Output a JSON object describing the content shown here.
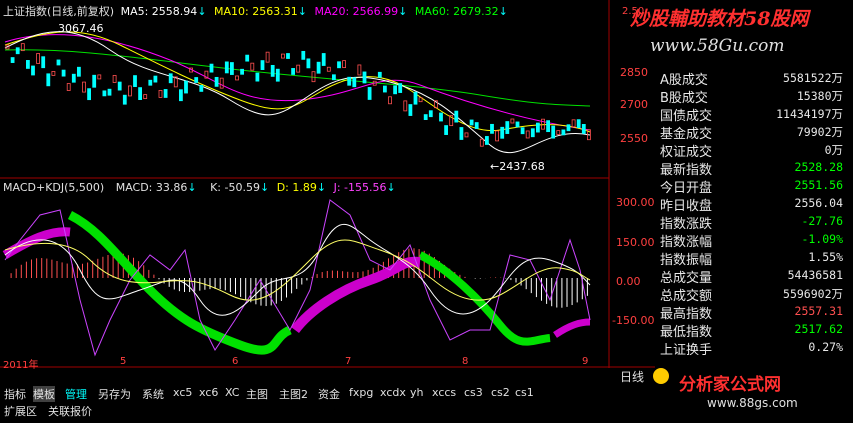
{
  "main_chart": {
    "title": "上证指数(日线,前复权)",
    "ma5": "MA5: 2558.94",
    "ma10": "MA10: 2563.31",
    "ma20": "MA20: 2566.99",
    "ma60": "MA60: 2679.32",
    "high_label": "3067.46",
    "low_label": "←2437.68",
    "right_axis": [
      "2850",
      "2700",
      "2550"
    ],
    "top_right_value": "2.50",
    "colors": {
      "ma5": "#ffffff",
      "ma10": "#ffff00",
      "ma20": "#ff00ff",
      "ma60": "#00ff00",
      "up": "#ff5050",
      "down": "#00ffff"
    }
  },
  "indicator": {
    "name": "MACD+KDJ(5,500)",
    "macd": "MACD: 33.86",
    "k": "K: -50.59",
    "d": "D: 1.89",
    "j": "J: -155.56",
    "right_axis": [
      "300.00",
      "150.00",
      "0.00",
      "-150.00"
    ]
  },
  "x_axis": {
    "labels": [
      "2011年",
      "5",
      "6",
      "7",
      "8",
      "9"
    ]
  },
  "watermark_top": {
    "line1": "炒股輔助教材58股网",
    "line2": "www.58Gu.com"
  },
  "watermark_bottom": {
    "site": "分析家公式网",
    "url": "www.88gs.com"
  },
  "side_panel": {
    "rows": [
      {
        "label": "A股成交",
        "value": "5581522万",
        "color": "#e8e8e8"
      },
      {
        "label": "B股成交",
        "value": "15380万",
        "color": "#e8e8e8"
      },
      {
        "label": "国债成交",
        "value": "11434197万",
        "color": "#e8e8e8"
      },
      {
        "label": "基金成交",
        "value": "79902万",
        "color": "#e8e8e8"
      },
      {
        "label": "权证成交",
        "value": "0万",
        "color": "#e8e8e8"
      },
      {
        "label": "最新指数",
        "value": "2528.28",
        "color": "#00ff00"
      },
      {
        "label": "今日开盘",
        "value": "2551.56",
        "color": "#00ff00"
      },
      {
        "label": "昨日收盘",
        "value": "2556.04",
        "color": "#e8e8e8"
      },
      {
        "label": "指数涨跌",
        "value": "-27.76",
        "color": "#00ff00"
      },
      {
        "label": "指数涨幅",
        "value": "-1.09%",
        "color": "#00ff00"
      },
      {
        "label": "指数振幅",
        "value": "1.55%",
        "color": "#e8e8e8"
      },
      {
        "label": "总成交量",
        "value": "54436581",
        "color": "#e8e8e8"
      },
      {
        "label": "总成交额",
        "value": "5596902万",
        "color": "#e8e8e8"
      },
      {
        "label": "最高指数",
        "value": "2557.31",
        "color": "#ff5050"
      },
      {
        "label": "最低指数",
        "value": "2517.62",
        "color": "#00ff00"
      },
      {
        "label": "上证换手",
        "value": "0.27%",
        "color": "#e8e8e8"
      }
    ],
    "tab": "日线"
  },
  "toolbar": {
    "row1": [
      "指标",
      "模板",
      "管理",
      "另存为",
      "系统",
      "xc5",
      "xc6",
      "XC",
      "主图",
      "主图2",
      "资金",
      "fxpg",
      "xcdx",
      "yh",
      "xccs",
      "cs3",
      "cs2",
      "cs1"
    ],
    "row2": [
      "扩展区",
      "关联报价"
    ]
  }
}
